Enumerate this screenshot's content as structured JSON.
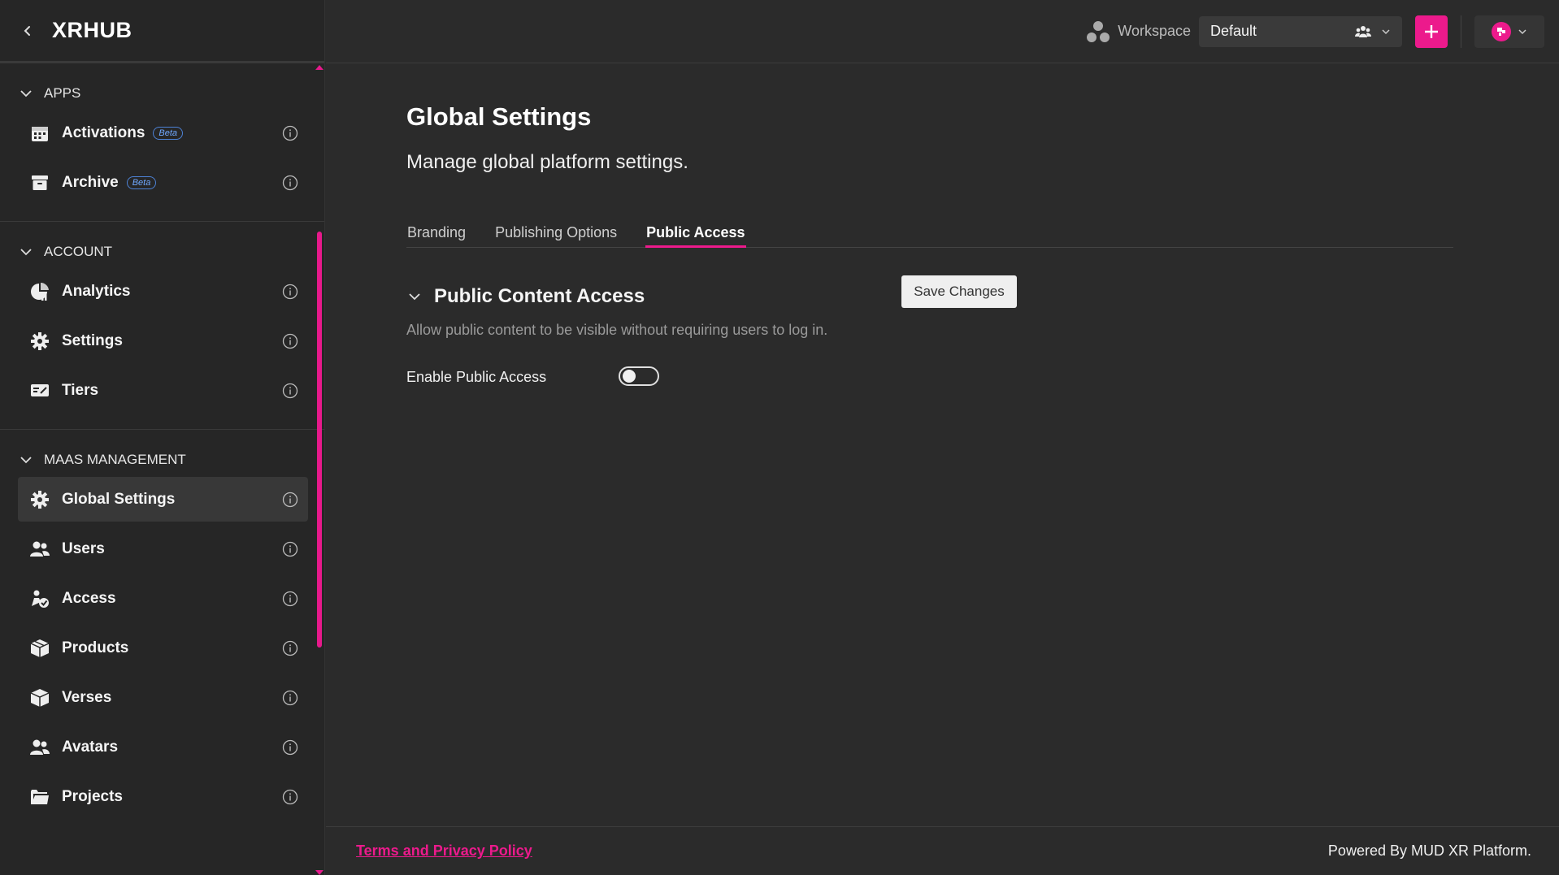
{
  "app": {
    "name": "XRHUB"
  },
  "colors": {
    "accent": "#ec1a8c",
    "background": "#2b2b2b",
    "sidebar": "#262626"
  },
  "sidebar": {
    "sections": [
      {
        "title": "APPS",
        "items": [
          {
            "label": "Activations",
            "icon": "calendar-icon",
            "badge": "Beta"
          },
          {
            "label": "Archive",
            "icon": "archive-icon",
            "badge": "Beta"
          }
        ]
      },
      {
        "title": "ACCOUNT",
        "items": [
          {
            "label": "Analytics",
            "icon": "analytics-icon"
          },
          {
            "label": "Settings",
            "icon": "gear-icon"
          },
          {
            "label": "Tiers",
            "icon": "tiers-icon"
          }
        ]
      },
      {
        "title": "MAAS MANAGEMENT",
        "items": [
          {
            "label": "Global Settings",
            "icon": "gear-icon",
            "active": true
          },
          {
            "label": "Users",
            "icon": "users-icon"
          },
          {
            "label": "Access",
            "icon": "access-icon"
          },
          {
            "label": "Products",
            "icon": "products-icon"
          },
          {
            "label": "Verses",
            "icon": "cube-icon"
          },
          {
            "label": "Avatars",
            "icon": "users-icon"
          },
          {
            "label": "Projects",
            "icon": "folder-icon"
          }
        ]
      }
    ]
  },
  "topbar": {
    "workspace_label": "Workspace",
    "workspace_value": "Default"
  },
  "main": {
    "title": "Global Settings",
    "subtitle": "Manage global platform settings.",
    "tabs": [
      {
        "label": "Branding",
        "active": false
      },
      {
        "label": "Publishing Options",
        "active": false
      },
      {
        "label": "Public Access",
        "active": true
      }
    ],
    "section": {
      "title": "Public Content Access",
      "description": "Allow public content to be visible without requiring users to log in.",
      "save_label": "Save Changes",
      "field_label": "Enable Public Access",
      "toggle_on": false
    }
  },
  "footer": {
    "terms_link": "Terms and Privacy Policy",
    "powered": "Powered By MUD XR Platform."
  }
}
